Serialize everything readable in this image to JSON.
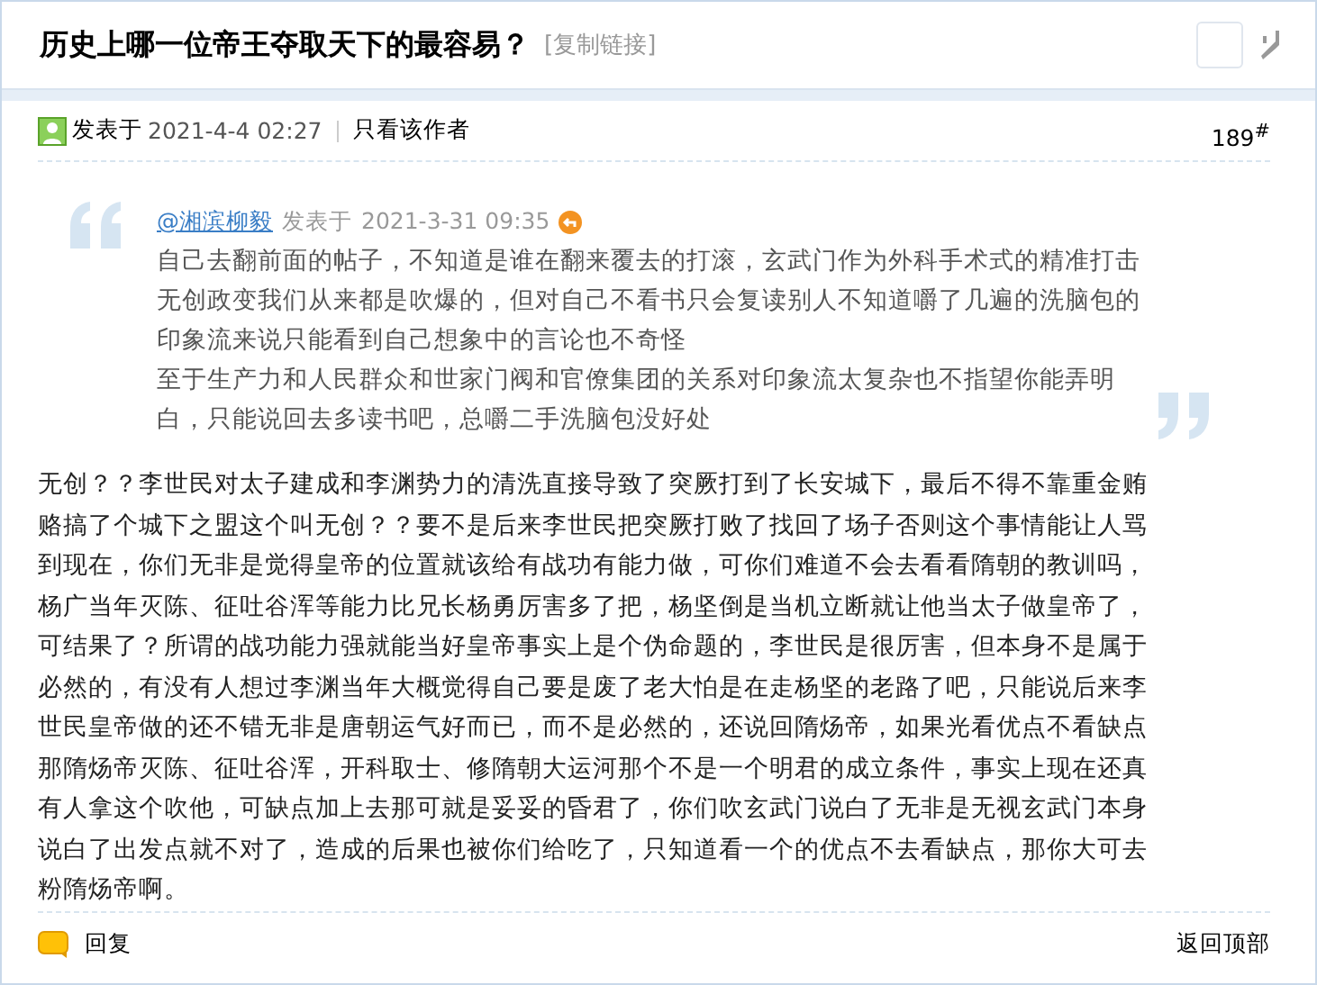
{
  "thread": {
    "title": "历史上哪一位帝王夺取天下的最容易？",
    "copy_link": "[复制链接]"
  },
  "post": {
    "posted_label": "发表于",
    "posted_time": "2021-4-4 02:27",
    "author_only": "只看该作者",
    "floor": "189",
    "floor_mark": "#",
    "quote": {
      "user": "@湘滨柳毅",
      "posted_label": "发表于",
      "posted_time": "2021-3-31 09:35",
      "paragraphs": [
        "自己去翻前面的帖子，不知道是谁在翻来覆去的打滚，玄武门作为外科手术式的精准打击无创政变我们从来都是吹爆的，但对自己不看书只会复读别人不知道嚼了几遍的洗脑包的印象流来说只能看到自己想象中的言论也不奇怪",
        "至于生产力和人民群众和世家门阀和官僚集团的关系对印象流太复杂也不指望你能弄明白，只能说回去多读书吧，总嚼二手洗脑包没好处"
      ]
    },
    "body": "无创？？李世民对太子建成和李渊势力的清洗直接导致了突厥打到了长安城下，最后不得不靠重金贿赂搞了个城下之盟这个叫无创？？要不是后来李世民把突厥打败了找回了场子否则这个事情能让人骂到现在，你们无非是觉得皇帝的位置就该给有战功有能力做，可你们难道不会去看看隋朝的教训吗，杨广当年灭陈、征吐谷浑等能力比兄长杨勇厉害多了把，杨坚倒是当机立断就让他当太子做皇帝了，可结果了？所谓的战功能力强就能当好皇帝事实上是个伪命题的，李世民是很厉害，但本身不是属于必然的，有没有人想过李渊当年大概觉得自己要是废了老大怕是在走杨坚的老路了吧，只能说后来李世民皇帝做的还不错无非是唐朝运气好而已，而不是必然的，还说回隋炀帝，如果光看优点不看缺点那隋炀帝灭陈、征吐谷浑，开科取士、修隋朝大运河那个不是一个明君的成立条件，事实上现在还真有人拿这个吹他，可缺点加上去那可就是妥妥的昏君了，你们吹玄武门说白了无非是无视玄武门本身说白了出发点就不对了，造成的后果也被你们给吃了，只知道看一个的优点不去看缺点，那你大可去粉隋炀帝啊。",
    "reply": "回复",
    "back_to_top": "返回顶部"
  }
}
